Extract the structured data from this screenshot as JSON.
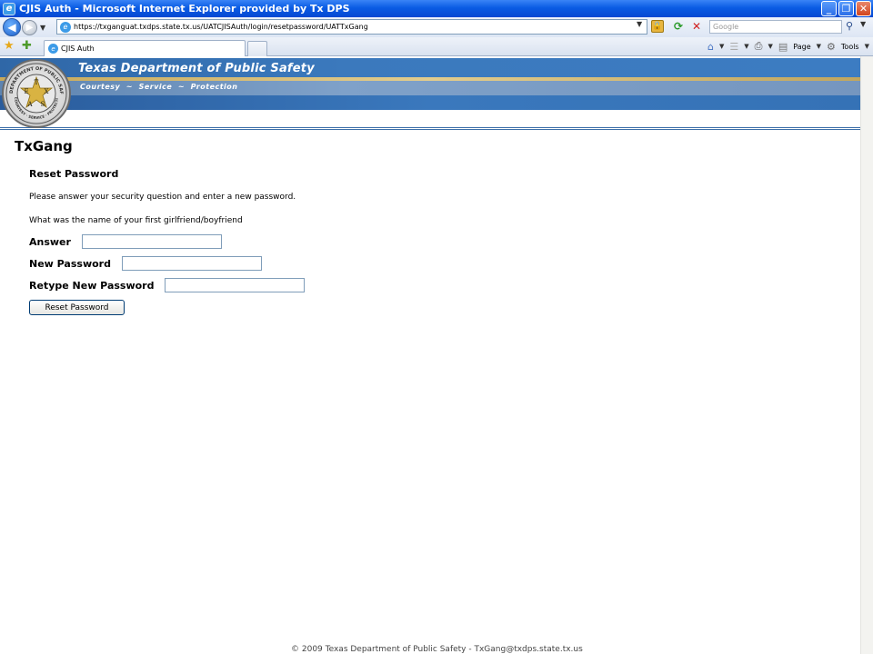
{
  "window": {
    "title": "CJIS Auth - Microsoft Internet Explorer provided by Tx DPS",
    "minimize": "_",
    "restore": "❐",
    "close": "✕"
  },
  "address_bar": {
    "url": "https://txganguat.txdps.state.tx.us/UATCJISAuth/login/resetpassword/UATTxGang",
    "search_placeholder": "Google"
  },
  "tabs": [
    {
      "label": "CJIS Auth",
      "active": true
    }
  ],
  "command_bar": {
    "page_label": "Page",
    "tools_label": "Tools"
  },
  "banner": {
    "title": "Texas Department of Public Safety",
    "motto": "Courtesy  ~  Service  ~  Protection",
    "seal_top_text": "DEPARTMENT OF PUBLIC SAFETY",
    "seal_bottom_text": "COURTESY · SERVICE · PROTECTION",
    "seal_letters": [
      "T",
      "E",
      "X",
      "A",
      "S"
    ]
  },
  "page": {
    "app_title": "TxGang",
    "section_title": "Reset Password",
    "instructions": "Please answer your security question and enter a new password.",
    "security_question": "What was the name of your first girlfriend/boyfriend",
    "form": {
      "answer_label": "Answer",
      "answer_value": "",
      "new_password_label": "New Password",
      "new_password_value": "",
      "retype_label": "Retype New Password",
      "retype_value": "",
      "submit_label": "Reset Password"
    },
    "footer": "© 2009 Texas Department of Public Safety - TxGang@txdps.state.tx.us"
  },
  "colors": {
    "titlebar": "#0a5ce4",
    "banner_blue": "#3b79bd",
    "banner_gold": "#e2cc8d"
  }
}
